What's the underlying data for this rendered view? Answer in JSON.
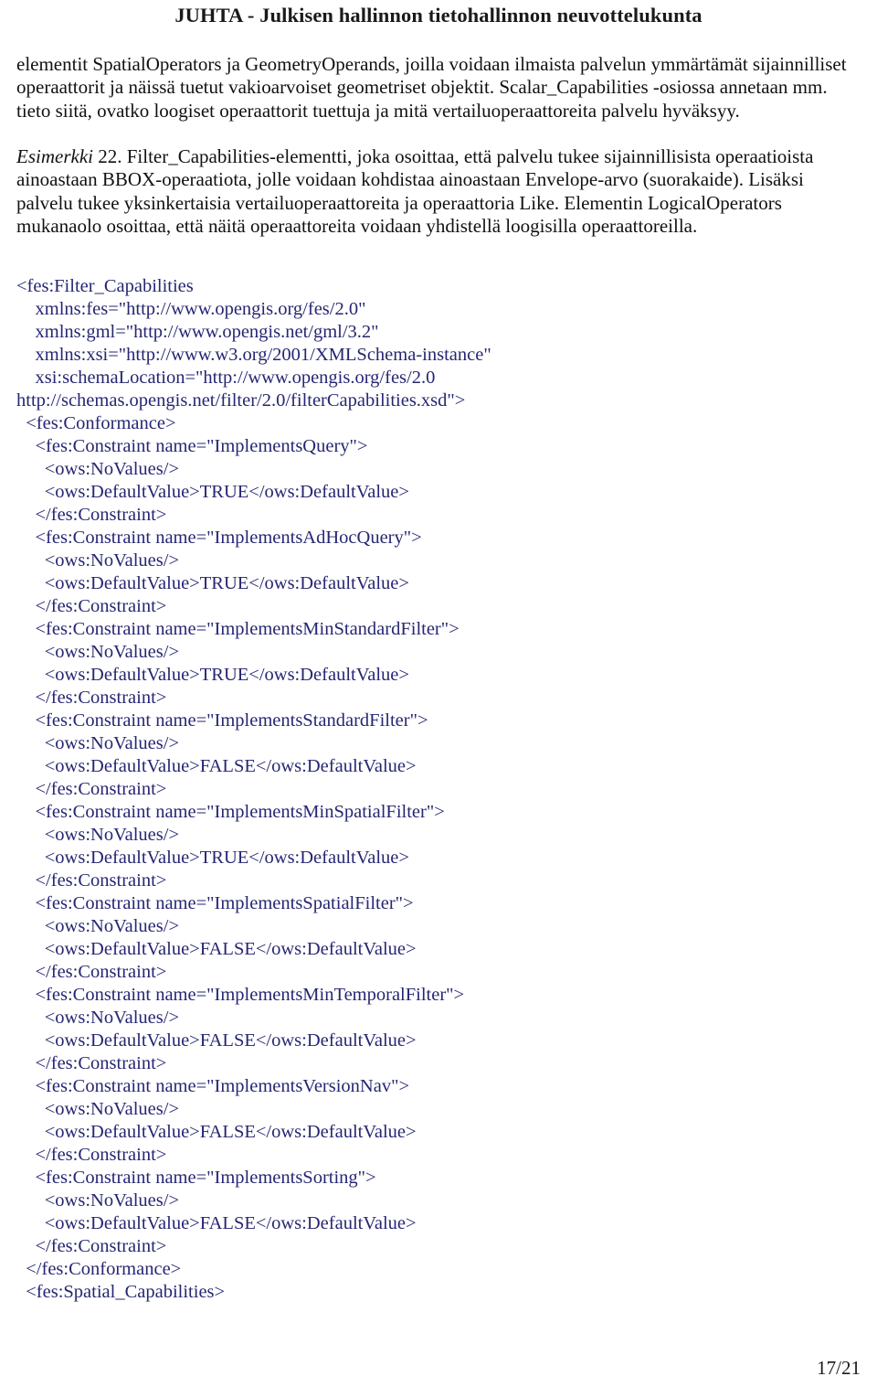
{
  "document": {
    "header_title": "JUHTA - Julkisen hallinnon tietohallinnon neuvottelukunta",
    "footer_page": "17/21",
    "xml_color": "#262673",
    "text_color": "#111111"
  },
  "paragraphs": {
    "intro": "elementit SpatialOperators ja GeometryOperands, joilla voidaan ilmaista palvelun ymmärtämät sijainnilliset operaattorit ja näissä tuetut vakioarvoiset geometriset objektit. Scalar_Capabilities -osiossa annetaan mm. tieto siitä, ovatko loogiset operaattorit tuettuja ja mitä vertailuoperaattoreita palvelu hyväksyy.",
    "example_label": "Esimerkki",
    "example_body": " 22. Filter_Capabilities-elementti, joka osoittaa, että palvelu tukee sijainnillisista operaatioista ainoastaan BBOX-operaatiota, jolle voidaan kohdistaa ainoastaan Envelope-arvo (suorakaide). Lisäksi palvelu tukee yksinkertaisia vertailuoperaattoreita ja operaattoria Like. Elementin LogicalOperators mukanaolo osoittaa, että näitä operaattoreita voidaan yhdistellä loogisilla operaattoreilla."
  },
  "code": {
    "language": "xml",
    "lines": [
      "<fes:Filter_Capabilities",
      "    xmlns:fes=\"http://www.opengis.org/fes/2.0\"",
      "    xmlns:gml=\"http://www.opengis.net/gml/3.2\"",
      "    xmlns:xsi=\"http://www.w3.org/2001/XMLSchema-instance\"",
      "    xsi:schemaLocation=\"http://www.opengis.org/fes/2.0",
      "http://schemas.opengis.net/filter/2.0/filterCapabilities.xsd\">",
      "  <fes:Conformance>",
      "    <fes:Constraint name=\"ImplementsQuery\">",
      "      <ows:NoValues/>",
      "      <ows:DefaultValue>TRUE</ows:DefaultValue>",
      "    </fes:Constraint>",
      "    <fes:Constraint name=\"ImplementsAdHocQuery\">",
      "      <ows:NoValues/>",
      "      <ows:DefaultValue>TRUE</ows:DefaultValue>",
      "    </fes:Constraint>",
      "    <fes:Constraint name=\"ImplementsMinStandardFilter\">",
      "      <ows:NoValues/>",
      "      <ows:DefaultValue>TRUE</ows:DefaultValue>",
      "    </fes:Constraint>",
      "    <fes:Constraint name=\"ImplementsStandardFilter\">",
      "      <ows:NoValues/>",
      "      <ows:DefaultValue>FALSE</ows:DefaultValue>",
      "    </fes:Constraint>",
      "    <fes:Constraint name=\"ImplementsMinSpatialFilter\">",
      "      <ows:NoValues/>",
      "      <ows:DefaultValue>TRUE</ows:DefaultValue>",
      "    </fes:Constraint>",
      "    <fes:Constraint name=\"ImplementsSpatialFilter\">",
      "      <ows:NoValues/>",
      "      <ows:DefaultValue>FALSE</ows:DefaultValue>",
      "    </fes:Constraint>",
      "    <fes:Constraint name=\"ImplementsMinTemporalFilter\">",
      "      <ows:NoValues/>",
      "      <ows:DefaultValue>FALSE</ows:DefaultValue>",
      "    </fes:Constraint>",
      "    <fes:Constraint name=\"ImplementsVersionNav\">",
      "      <ows:NoValues/>",
      "      <ows:DefaultValue>FALSE</ows:DefaultValue>",
      "    </fes:Constraint>",
      "    <fes:Constraint name=\"ImplementsSorting\">",
      "      <ows:NoValues/>",
      "      <ows:DefaultValue>FALSE</ows:DefaultValue>",
      "    </fes:Constraint>",
      "  </fes:Conformance>",
      "  <fes:Spatial_Capabilities>"
    ]
  }
}
